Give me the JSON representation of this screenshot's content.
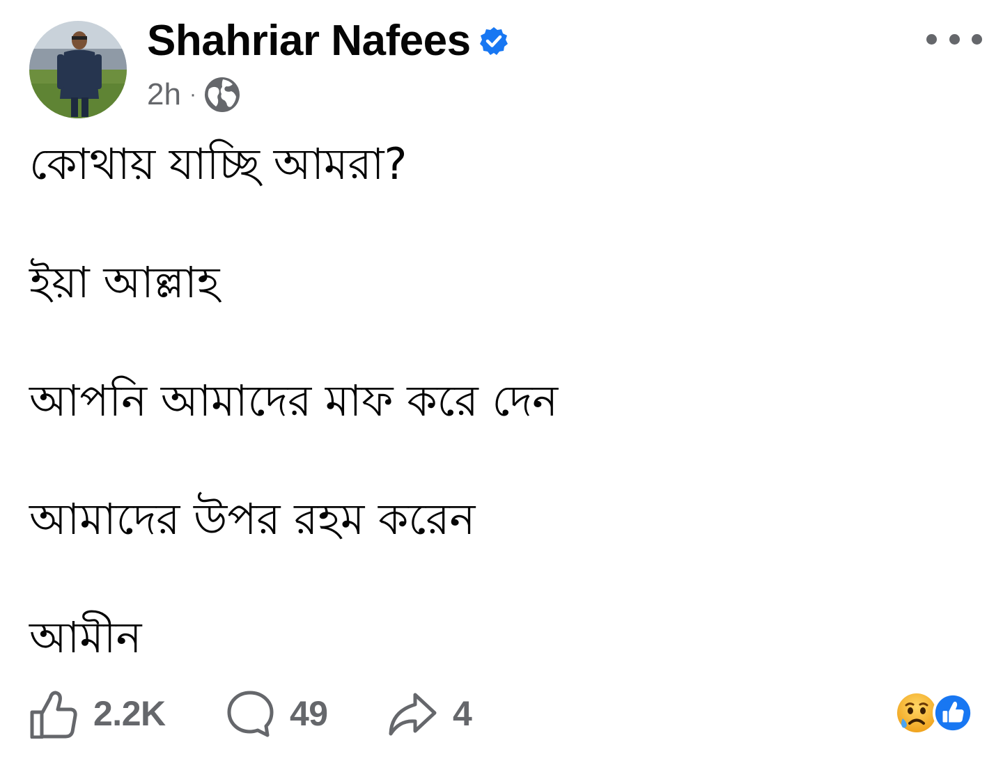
{
  "post": {
    "author": "Shahriar Nafees",
    "verified": true,
    "time": "2h",
    "separator": "·",
    "audience_icon": "globe-icon",
    "more_icon": "more-horizontal-icon",
    "lines": [
      "কোথায় যাচ্ছি আমরা?",
      "ইয়া আল্লাহ",
      "আপনি আমাদের মাফ করে দেন",
      "আমাদের উপর রহম করেন",
      "আমীন"
    ]
  },
  "actions": {
    "like_count": "2.2K",
    "comment_count": "49",
    "share_count": "4"
  },
  "reactions": {
    "items": [
      "sad-reaction-icon",
      "like-reaction-icon"
    ]
  },
  "colors": {
    "verified_blue": "#1877f2",
    "secondary_text": "#65676b",
    "primary_text": "#050505",
    "like_blue": "#1877f2",
    "sad_yellow": "#f7b125"
  }
}
